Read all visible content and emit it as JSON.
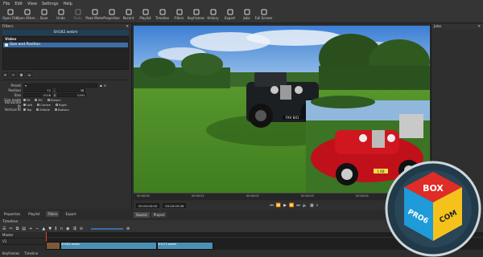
{
  "menu": [
    "File",
    "Edit",
    "View",
    "Settings",
    "Help"
  ],
  "toolbar": [
    {
      "label": "Open File",
      "icon": "folder-icon",
      "dim": false
    },
    {
      "label": "Open Other...",
      "icon": "open-other-icon",
      "dim": false
    },
    {
      "label": "Save",
      "icon": "save-icon",
      "dim": false
    },
    {
      "label": "Undo",
      "icon": "undo-icon",
      "dim": false
    },
    {
      "label": "Redo",
      "icon": "redo-icon",
      "dim": true
    },
    {
      "label": "Peak Meter",
      "icon": "peak-meter-icon",
      "dim": false
    },
    {
      "label": "Properties",
      "icon": "properties-icon",
      "dim": false
    },
    {
      "label": "Recent",
      "icon": "recent-icon",
      "dim": false
    },
    {
      "label": "Playlist",
      "icon": "playlist-icon",
      "dim": false
    },
    {
      "label": "Timeline",
      "icon": "timeline-icon",
      "dim": false
    },
    {
      "label": "Filters",
      "icon": "filters-icon",
      "dim": false
    },
    {
      "label": "Keyframes",
      "icon": "keyframes-icon",
      "dim": false
    },
    {
      "label": "History",
      "icon": "history-icon",
      "dim": false
    },
    {
      "label": "Export",
      "icon": "export-icon",
      "dim": false
    },
    {
      "label": "Jobs",
      "icon": "jobs-icon",
      "dim": false
    },
    {
      "label": "Full Screen",
      "icon": "fullscreen-icon",
      "dim": false
    }
  ],
  "filters": {
    "title": "Filters",
    "clip_name": "SH182.webm",
    "group": "Video",
    "item": "Size and Position",
    "preset_label": "Preset",
    "position_label": "Position",
    "position_x": "72",
    "position_y": "38",
    "size_label": "Size",
    "size_w": "2118",
    "size_h": "1191",
    "size_mode_label": "Size mode",
    "size_mode": [
      "Fit",
      "Fill",
      "Distort"
    ],
    "hfit_label": "Horizontal fit",
    "hfit": [
      "Left",
      "Centre",
      "Right"
    ],
    "vfit_label": "Vertical fit",
    "vfit": [
      "Top",
      "Middle",
      "Bottom"
    ]
  },
  "left_tabs": [
    "Properties",
    "Playlist",
    "Filters",
    "Export"
  ],
  "right_panel": {
    "title": "Jobs"
  },
  "viewer": {
    "ruler_ticks": [
      "00:00:00",
      "00:00:01",
      "00:00:02",
      "00:00:03",
      "00:00:04",
      "00:00:05"
    ],
    "timecode_current": "00:00:00:00",
    "timecode_total": "00:00:05:06",
    "source_tabs": [
      "Source",
      "Project"
    ],
    "plate_main": "YXV 841",
    "plate_inset": "1 KB"
  },
  "timeline": {
    "title": "Timeline",
    "tracks": [
      "Master",
      "V1"
    ],
    "clip_labels": [
      "SH182.webm",
      "SH177.webm"
    ]
  },
  "bottom_tabs": [
    "Keyframes",
    "Timeline"
  ],
  "logo": {
    "top": "BOX",
    "left": "PRO6",
    "right": "COM"
  },
  "colors": {
    "accent": "#3a6ea5",
    "clip": "#4b8fb5"
  }
}
